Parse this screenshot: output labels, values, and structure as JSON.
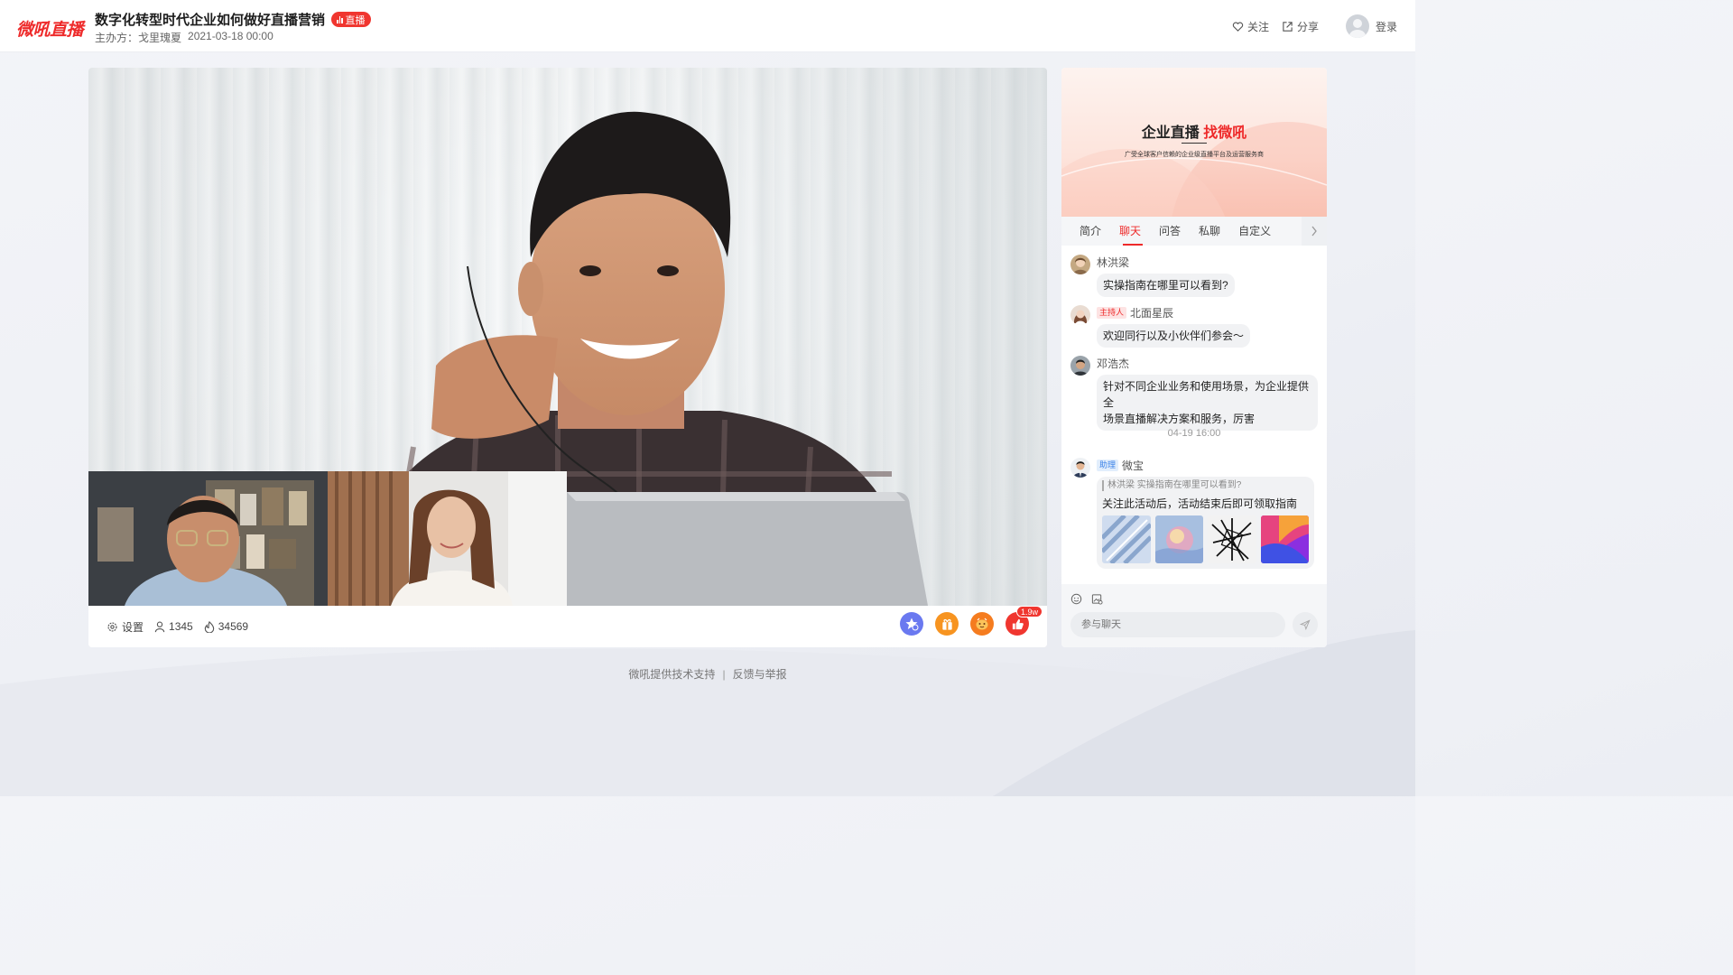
{
  "header": {
    "logo": "微吼直播",
    "title": "数字化转型时代企业如何做好直播营销",
    "live_badge": "直播",
    "host_label": "主办方：",
    "host_name": "戈里瑰夏",
    "date": "2021-03-18 00:00",
    "follow": "关注",
    "share": "分享",
    "login": "登录"
  },
  "player": {
    "settings": "设置",
    "viewers": "1345",
    "hot": "34569",
    "like_count": "1.9w",
    "icons": [
      "favorite-star-icon",
      "gift-box-icon",
      "red-packet-icon",
      "thumbs-up-icon"
    ]
  },
  "banner": {
    "title_black": "企业直播 ",
    "title_red": "找微吼",
    "subtitle": "广受全球客户信赖的企业级直播平台及运营服务商"
  },
  "tabs": [
    "简介",
    "聊天",
    "问答",
    "私聊",
    "自定义"
  ],
  "active_tab": "聊天",
  "chat": {
    "messages": [
      {
        "name": "林洪梁",
        "role": "",
        "text": "实操指南在哪里可以看到?"
      },
      {
        "name": "北面星辰",
        "role": "主持人",
        "text": "欢迎同行以及小伙伴们参会～"
      },
      {
        "name": "邓浩杰",
        "role": "",
        "text_line1": "针对不同企业业务和使用场景，为企业提供全",
        "text_line2": "场景直播解决方案和服务，厉害"
      }
    ],
    "time_divider": "04-19 16:00",
    "assistant": {
      "role": "助理",
      "name": "微宝",
      "quote": "林洪梁 实操指南在哪里可以看到?",
      "text": "关注此活动后，活动结束后即可领取指南"
    },
    "input_placeholder": "参与聊天"
  },
  "footer": {
    "support": "微吼提供技术支持",
    "separator": "|",
    "report": "反馈与举报"
  },
  "colors": {
    "brand_red": "#ee2a2a",
    "assist_blue": "#3c83e8"
  }
}
